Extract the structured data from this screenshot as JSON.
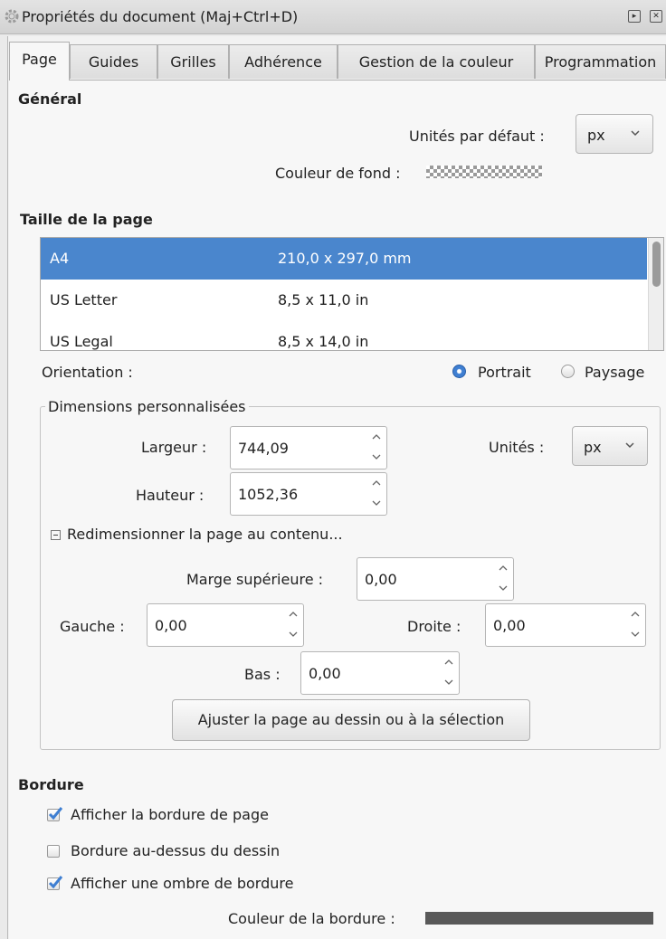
{
  "window": {
    "title": "Propriétés du document (Maj+Ctrl+D)",
    "controls": [
      "▸",
      "✕"
    ]
  },
  "tabs": [
    {
      "label": "Page",
      "active": true
    },
    {
      "label": "Guides",
      "active": false
    },
    {
      "label": "Grilles",
      "active": false
    },
    {
      "label": "Adhérence",
      "active": false
    },
    {
      "label": "Gestion de la couleur",
      "active": false
    },
    {
      "label": "Programmation",
      "active": false
    }
  ],
  "general": {
    "heading": "Général",
    "default_units_label": "Unités par défaut :",
    "default_units_value": "px",
    "bg_color_label": "Couleur de fond :"
  },
  "page_size": {
    "heading": "Taille de la page",
    "list": [
      {
        "name": "A4",
        "size": "210,0 x 297,0 mm",
        "selected": true
      },
      {
        "name": "US Letter",
        "size": "8,5 x 11,0 in",
        "selected": false
      },
      {
        "name": "US Legal",
        "size": "8,5 x 14,0 in",
        "selected": false
      }
    ],
    "orientation_label": "Orientation :",
    "portrait_label": "Portrait",
    "landscape_label": "Paysage",
    "portrait_selected": true
  },
  "custom": {
    "title": "Dimensions personnalisées",
    "width_label": "Largeur :",
    "width_value": "744,09",
    "height_label": "Hauteur :",
    "height_value": "1052,36",
    "units_label": "Unités :",
    "units_value": "px",
    "resize_label": "Redimensionner la page au contenu...",
    "top_margin_label": "Marge supérieure :",
    "top_margin_value": "0,00",
    "left_label": "Gauche :",
    "left_value": "0,00",
    "right_label": "Droite :",
    "right_value": "0,00",
    "bottom_label": "Bas :",
    "bottom_value": "0,00",
    "fit_button": "Ajuster la page au dessin ou à la sélection"
  },
  "border": {
    "heading": "Bordure",
    "show_border": {
      "label": "Afficher la bordure de page",
      "checked": true
    },
    "border_on_top": {
      "label": "Bordure au-dessus du dessin",
      "checked": false
    },
    "show_shadow": {
      "label": "Afficher une ombre de bordure",
      "checked": true
    },
    "color_label": "Couleur de la bordure :",
    "color": "#595959"
  },
  "colors": {
    "selection": "#4a86cd",
    "check": "#3f7fd2"
  }
}
